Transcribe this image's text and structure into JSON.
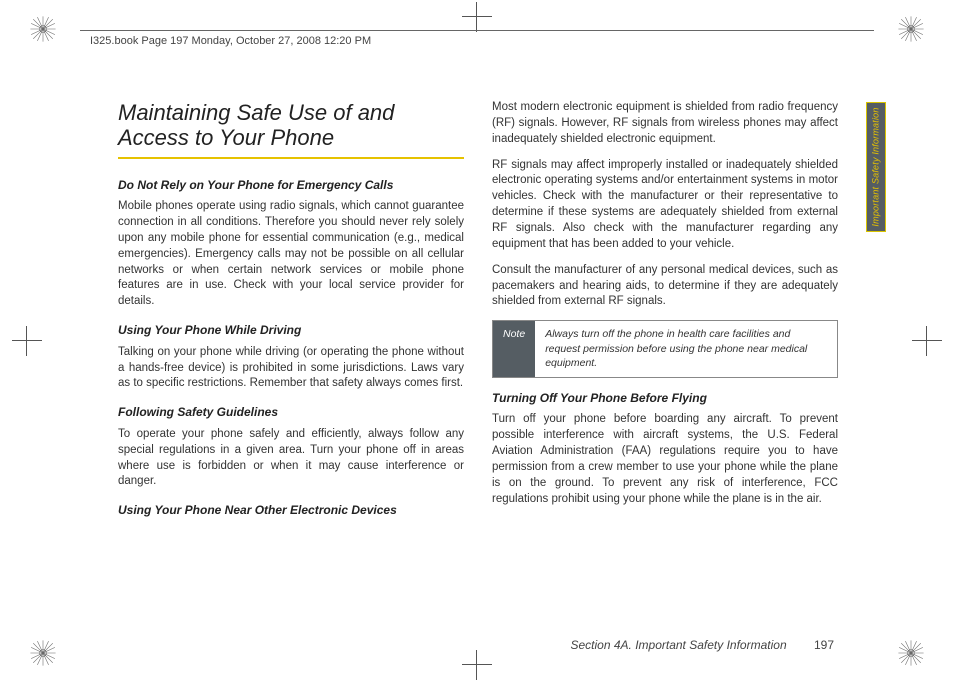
{
  "header": {
    "runner": "I325.book  Page 197  Monday, October 27, 2008  12:20 PM"
  },
  "title": "Maintaining Safe Use of and Access to Your Phone",
  "side_tab": "Important Safety Information",
  "left": {
    "h1": "Do Not Rely on Your Phone for Emergency Calls",
    "p1": "Mobile phones operate using radio signals, which cannot guarantee connection in all conditions. Therefore you should never rely solely upon any mobile phone for essential communication (e.g., medical emergencies). Emergency calls may not be possible on all cellular networks or when certain network services or mobile phone features are in use. Check with your local service provider for details.",
    "h2": "Using Your Phone While Driving",
    "p2": "Talking on your phone while driving (or operating the phone without a hands-free device) is prohibited in some jurisdictions. Laws vary as to specific restrictions. Remember that safety always comes first.",
    "h3": "Following Safety Guidelines",
    "p3": "To operate your phone safely and efficiently, always follow any special regulations in a given area. Turn your phone off in areas where use is forbidden or when it may cause interference or danger.",
    "h4": "Using Your Phone Near Other Electronic Devices"
  },
  "right": {
    "p1": "Most modern electronic equipment is shielded from radio frequency (RF) signals. However, RF signals from wireless phones may affect inadequately shielded electronic equipment.",
    "p2": "RF signals may affect improperly installed or inadequately shielded electronic operating systems and/or entertainment systems in motor vehicles. Check with the manufacturer or their representative to determine if these systems are adequately shielded from external RF signals. Also check with the manufacturer regarding any equipment that has been added to your vehicle.",
    "p3": "Consult the manufacturer of any personal medical devices, such as pacemakers and hearing aids, to determine if they are adequately shielded from external RF signals.",
    "note_label": "Note",
    "note_body": "Always turn off the phone in health care facilities and request permission before using the phone near medical equipment.",
    "h1": "Turning Off Your Phone Before Flying",
    "p4": "Turn off your phone before boarding any aircraft. To prevent possible interference with aircraft systems, the U.S. Federal Aviation Administration (FAA) regulations require you to have permission from a crew member to use your phone while the plane is on the ground. To prevent any risk of interference, FCC regulations prohibit using your phone while the plane is in the air."
  },
  "footer": {
    "section": "Section 4A. Important Safety Information",
    "page": "197"
  }
}
